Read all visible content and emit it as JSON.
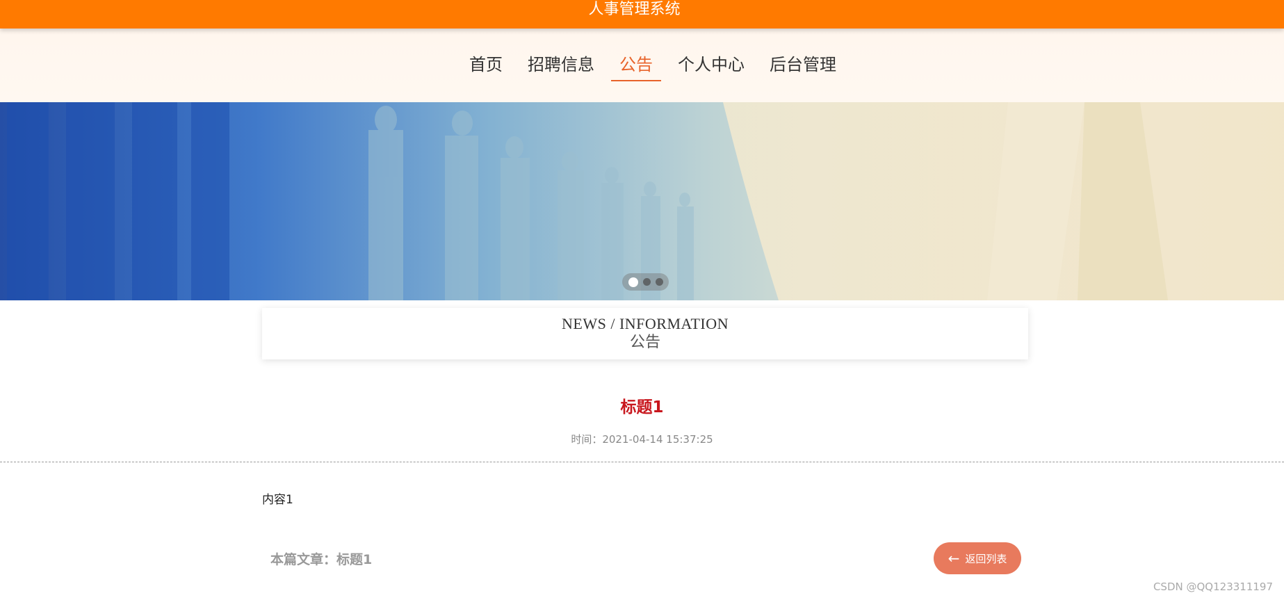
{
  "app": {
    "title": "人事管理系统"
  },
  "nav": {
    "items": [
      {
        "label": "首页"
      },
      {
        "label": "招聘信息"
      },
      {
        "label": "公告"
      },
      {
        "label": "个人中心"
      },
      {
        "label": "后台管理"
      }
    ],
    "active": "公告"
  },
  "banner": {
    "slides": 3,
    "active_slide": 1
  },
  "section": {
    "en": "NEWS / INFORMATION",
    "cn": "公告"
  },
  "article": {
    "title": "标题1",
    "time": "时间：2021-04-14 15:37:25",
    "content": "内容1",
    "current_label": "本篇文章：标题1"
  },
  "actions": {
    "back_label": "返回列表"
  },
  "watermark": "CSDN @QQ123311197",
  "colors": {
    "header": "#ff7a00",
    "accent": "#e8632a",
    "title": "#c8161d",
    "button": "#e87a5d"
  }
}
